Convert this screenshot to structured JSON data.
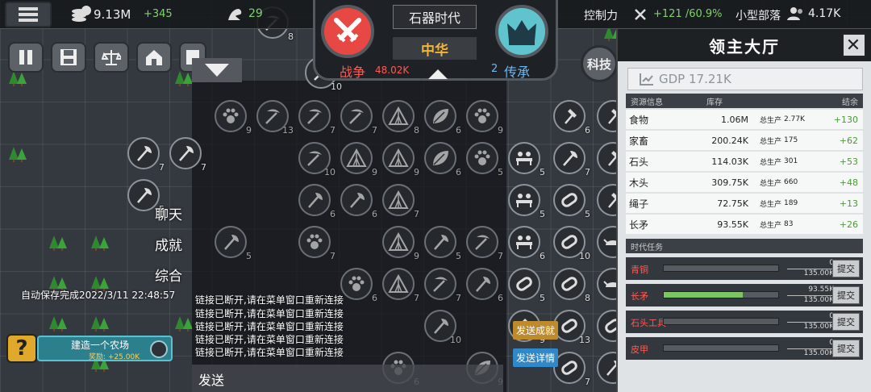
{
  "topbar": {
    "gold": "9.13M",
    "gold_delta": "+345",
    "strength": "29",
    "control_label": "控制力",
    "control_value": "+121 /60.9%",
    "tribe_label": "小型部落",
    "population": "4.17K"
  },
  "hud": {
    "era": "石器时代",
    "nation": "中华",
    "war_label": "战争",
    "war_value": "48.02K",
    "heritage_count": "2",
    "heritage_label": "传承",
    "tech_label": "科技"
  },
  "chat": {
    "tabs": [
      "聊天",
      "成就",
      "综合"
    ],
    "autosave": "自动保存完成2022/3/11 22:48:57",
    "messages": [
      "链接已断开,请在菜单窗口重新连接",
      "链接已断开,请在菜单窗口重新连接",
      "链接已断开,请在菜单窗口重新连接",
      "链接已断开,请在菜单窗口重新连接",
      "链接已断开,请在菜单窗口重新连接"
    ],
    "send_label": "发送",
    "send_achievement": "发送成就",
    "send_details": "发送详情"
  },
  "quest": {
    "title": "建造一个农场",
    "reward": "奖励: +25.00K"
  },
  "side": {
    "title": "领主大厅",
    "gdp_label": "GDP",
    "gdp_value": "17.21K",
    "headers": [
      "资源信息",
      "库存",
      "结余"
    ],
    "resources": [
      {
        "name": "食物",
        "stock": "1.06M",
        "prod_label": "总生产",
        "prod": "2.77K",
        "balance": "+130"
      },
      {
        "name": "家畜",
        "stock": "200.24K",
        "prod_label": "总生产",
        "prod": "175",
        "balance": "+62"
      },
      {
        "name": "石头",
        "stock": "114.03K",
        "prod_label": "总生产",
        "prod": "301",
        "balance": "+53"
      },
      {
        "name": "木头",
        "stock": "309.75K",
        "prod_label": "总生产",
        "prod": "660",
        "balance": "+48"
      },
      {
        "name": "绳子",
        "stock": "72.75K",
        "prod_label": "总生产",
        "prod": "189",
        "balance": "+13"
      },
      {
        "name": "长矛",
        "stock": "93.55K",
        "prod_label": "总生产",
        "prod": "83",
        "balance": "+26"
      }
    ],
    "tasks_header": "时代任务",
    "tasks": [
      {
        "name": "青铜",
        "cur": "0",
        "target": "135.00K",
        "progress": 0,
        "button": "提交"
      },
      {
        "name": "长矛",
        "cur": "93.55K",
        "target": "135.00K",
        "progress": 0.693,
        "button": "提交"
      },
      {
        "name": "石头工具",
        "cur": "0",
        "target": "135.00K",
        "progress": 0,
        "button": "提交"
      },
      {
        "name": "皮甲",
        "cur": "0",
        "target": "135.00K",
        "progress": 0,
        "button": "提交"
      }
    ]
  },
  "tile_numbers": [
    "8",
    "10",
    "9",
    "13",
    "7",
    "7",
    "8",
    "6",
    "9",
    "6",
    "1",
    "7",
    "7",
    "10",
    "9",
    "9",
    "6",
    "5",
    "5",
    "7",
    "8",
    "5",
    "6",
    "6",
    "7",
    "5",
    "5",
    "6",
    "5",
    "7",
    "9",
    "5",
    "7",
    "6",
    "10",
    "6",
    "6",
    "7",
    "7",
    "6",
    "5",
    "8"
  ],
  "icons": {
    "menu": "menu-icon",
    "coin": "coin-stack-icon",
    "muscle": "strength-icon",
    "swords": "crossed-swords-icon",
    "crown": "crown-icon",
    "people": "population-icon",
    "pause": "pause-icon",
    "save": "save-icon",
    "law": "scales-icon",
    "build": "building-icon",
    "help": "question-icon"
  }
}
